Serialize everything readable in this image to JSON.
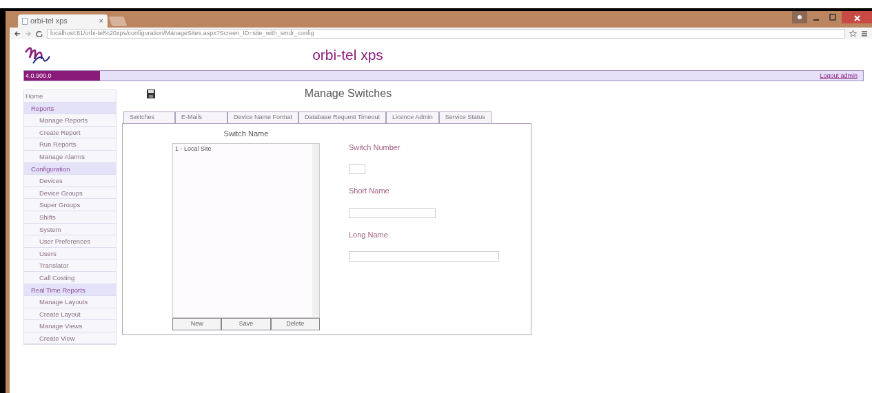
{
  "browser": {
    "tab_title": "orbi-tel xps",
    "tab_close": "×",
    "url": "localhost:81/orbi-tel%20xps/configuration/ManageSites.aspx?Screen_ID=site_with_smdr_config"
  },
  "header": {
    "title": "orbi-tel xps",
    "version": "4.0.900.0",
    "logout": "Logout admin"
  },
  "sidebar": {
    "items": [
      {
        "label": "Home",
        "kind": "top"
      },
      {
        "label": "Reports",
        "kind": "group"
      },
      {
        "label": "Manage Reports",
        "kind": "item"
      },
      {
        "label": "Create Report",
        "kind": "item"
      },
      {
        "label": "Run Reports",
        "kind": "item"
      },
      {
        "label": "Manage Alarms",
        "kind": "item"
      },
      {
        "label": "Configuration",
        "kind": "group"
      },
      {
        "label": "Devices",
        "kind": "item"
      },
      {
        "label": "Device Groups",
        "kind": "item"
      },
      {
        "label": "Super Groups",
        "kind": "item"
      },
      {
        "label": "Shifts",
        "kind": "item"
      },
      {
        "label": "System",
        "kind": "item"
      },
      {
        "label": "User Preferences",
        "kind": "item"
      },
      {
        "label": "Users",
        "kind": "item"
      },
      {
        "label": "Translator",
        "kind": "item"
      },
      {
        "label": "Call Costing",
        "kind": "item"
      },
      {
        "label": "Real Time Reports",
        "kind": "group"
      },
      {
        "label": "Manage Layouts",
        "kind": "item"
      },
      {
        "label": "Create Layout",
        "kind": "item"
      },
      {
        "label": "Manage Views",
        "kind": "item"
      },
      {
        "label": "Create View",
        "kind": "item"
      }
    ]
  },
  "page_title": "Manage Switches",
  "tabs": [
    {
      "label": "Switches"
    },
    {
      "label": "E-Mails"
    },
    {
      "label": "Device Name Format"
    },
    {
      "label": "Database Request Timeout"
    },
    {
      "label": "Licence Admin"
    },
    {
      "label": "Service Status"
    }
  ],
  "switch_list": {
    "heading": "Switch Name",
    "items": [
      {
        "label": "1 - Local Site"
      }
    ],
    "buttons": [
      "New",
      "Save",
      "Delete"
    ]
  },
  "fields": [
    {
      "label": "Switch Number"
    },
    {
      "label": "Short Name"
    },
    {
      "label": "Long Name"
    }
  ]
}
